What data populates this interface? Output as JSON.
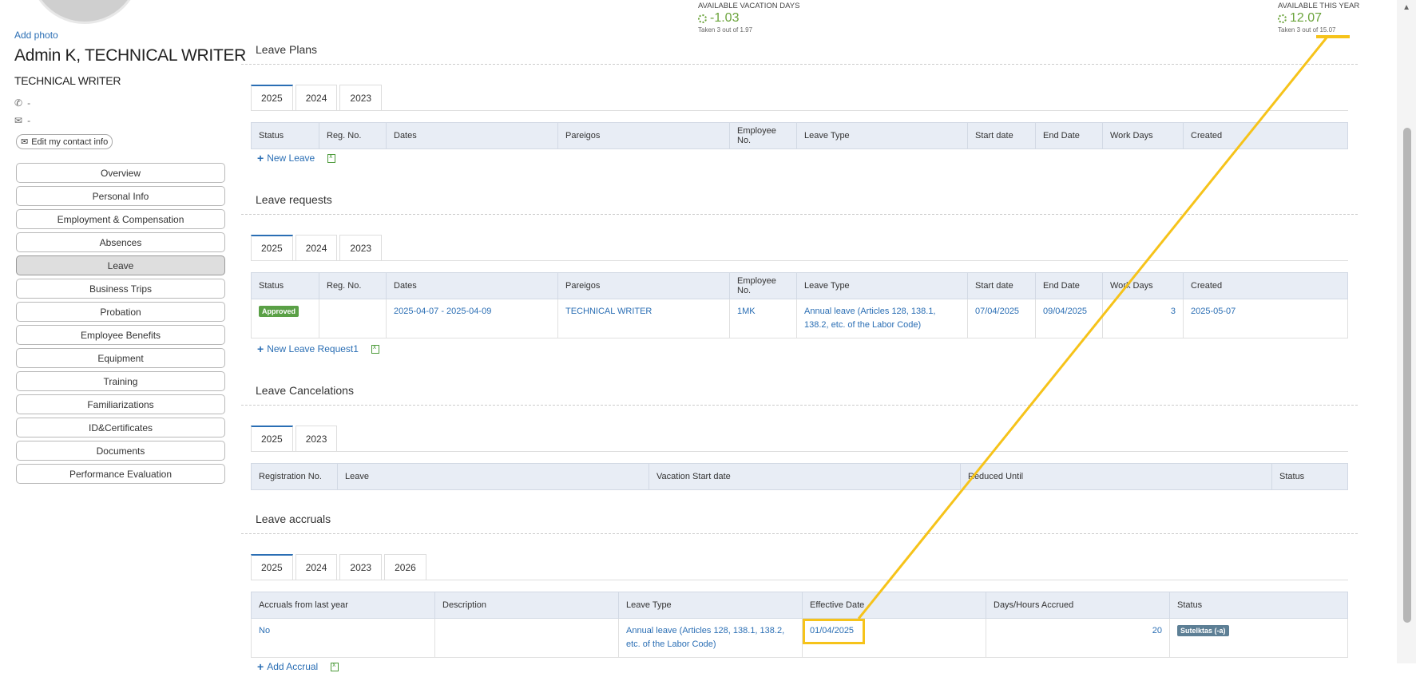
{
  "profile": {
    "add_photo": "Add photo",
    "name": "Admin K, TECHNICAL WRITER",
    "title": "TECHNICAL WRITER",
    "phone": "-",
    "email": "-",
    "edit_contact": "Edit my contact info"
  },
  "sidebar": {
    "items": [
      {
        "label": "Overview"
      },
      {
        "label": "Personal Info"
      },
      {
        "label": "Employment & Compensation"
      },
      {
        "label": "Absences"
      },
      {
        "label": "Leave",
        "active": true
      },
      {
        "label": "Business Trips"
      },
      {
        "label": "Probation"
      },
      {
        "label": "Employee Benefits"
      },
      {
        "label": "Equipment"
      },
      {
        "label": "Training"
      },
      {
        "label": "Familiarizations"
      },
      {
        "label": "ID&Certificates"
      },
      {
        "label": "Documents"
      },
      {
        "label": "Performance Evaluation"
      }
    ]
  },
  "summary": {
    "vacation": {
      "caption": "AVAILABLE VACATION DAYS",
      "value": "-1.03",
      "sub": "Taken 3 out of 1.97"
    },
    "this_year": {
      "caption": "AVAILABLE THIS YEAR",
      "value": "12.07",
      "sub": "Taken 3 out of 15.07"
    }
  },
  "leave_plans": {
    "title": "Leave Plans",
    "tabs": [
      "2025",
      "2024",
      "2023"
    ],
    "columns": [
      "Status",
      "Reg. No.",
      "Dates",
      "Pareigos",
      "Employee No.",
      "Leave Type",
      "Start date",
      "End Date",
      "Work Days",
      "Created"
    ],
    "add_label": "New Leave"
  },
  "leave_requests": {
    "title": "Leave requests",
    "tabs": [
      "2025",
      "2024",
      "2023"
    ],
    "columns": [
      "Status",
      "Reg. No.",
      "Dates",
      "Pareigos",
      "Employee No.",
      "Leave Type",
      "Start date",
      "End Date",
      "Work Days",
      "Created"
    ],
    "row": {
      "status": "Approved",
      "reg_no": "",
      "dates": "2025-04-07 - 2025-04-09",
      "pareigos": "TECHNICAL WRITER",
      "employee_no": "1MK",
      "leave_type_line1": "Annual leave (Articles 128, 138.1,",
      "leave_type_line2": "138.2, etc. of the Labor Code)",
      "start": "07/04/2025",
      "end": "09/04/2025",
      "work_days": "3",
      "created": "2025-05-07"
    },
    "add_label": "New Leave Request1"
  },
  "leave_cancelations": {
    "title": "Leave Cancelations",
    "tabs": [
      "2025",
      "2023"
    ],
    "columns": [
      "Registration No.",
      "Leave",
      "Vacation Start date",
      "Reduced Until",
      "Status"
    ]
  },
  "leave_accruals": {
    "title": "Leave accruals",
    "tabs": [
      "2025",
      "2024",
      "2023",
      "2026"
    ],
    "columns": [
      "Accruals from last year",
      "Description",
      "Leave Type",
      "Effective Date",
      "Days/Hours Accrued",
      "Status"
    ],
    "row": {
      "from_last_year": "No",
      "description": "",
      "leave_type_line1": "Annual leave (Articles 128, 138.1, 138.2,",
      "leave_type_line2": "etc. of the Labor Code)",
      "effective_date": "01/04/2025",
      "accrued": "20",
      "status": "Sutelktas (-a)"
    },
    "add_label": "Add Accrual"
  },
  "colors": {
    "link": "#2a6eb4",
    "approved": "#5aa046",
    "status_badge": "#5d7f95",
    "highlight": "#f6c31a",
    "summary_green": "#6aa33a"
  }
}
